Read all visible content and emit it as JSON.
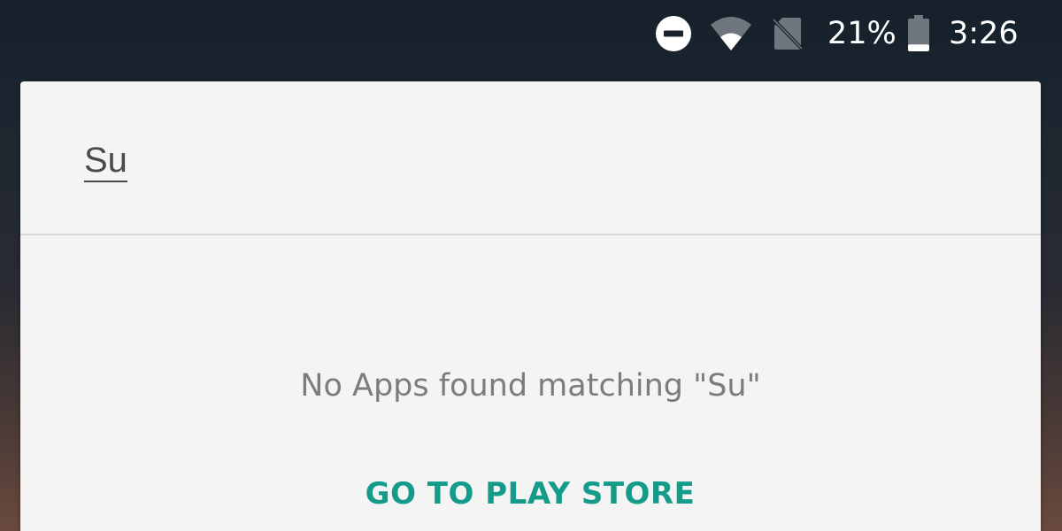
{
  "status_bar": {
    "icons": {
      "dnd": "do-not-disturb-icon",
      "wifi": "wifi-icon",
      "sim": "no-sim-icon",
      "battery": "battery-icon"
    },
    "battery_percent": "21%",
    "battery_level": 0.21,
    "time": "3:26"
  },
  "search": {
    "query": "Su"
  },
  "results": {
    "empty_message": "No Apps found matching \"Su\"",
    "action_label": "GO TO PLAY STORE"
  },
  "colors": {
    "accent": "#159b8a",
    "card_background": "#f4f4f4",
    "muted_text": "#7c7c7c"
  }
}
